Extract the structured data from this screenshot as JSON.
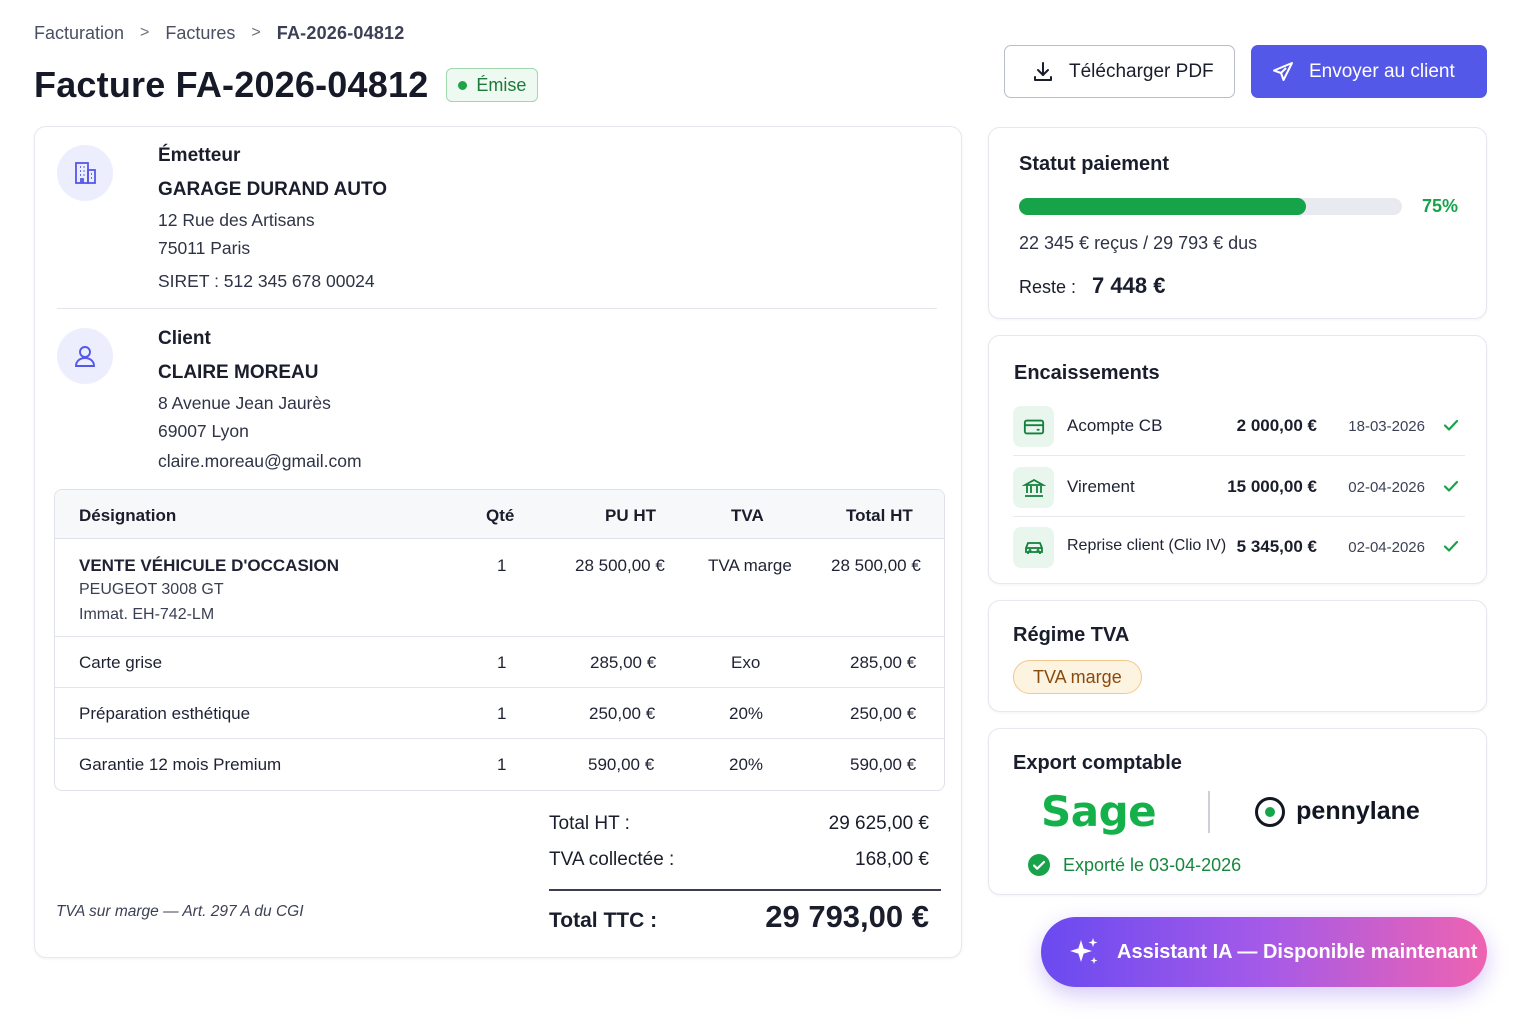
{
  "breadcrumb": {
    "items": [
      "Facturation",
      "Factures"
    ],
    "current": "FA-2026-04812",
    "separator": ">"
  },
  "header": {
    "title": "Facture FA-2026-04812",
    "status": "Émise",
    "download_label": "Télécharger PDF",
    "send_label": "Envoyer au client"
  },
  "issuer": {
    "role": "Émetteur",
    "name": "GARAGE DURAND AUTO",
    "address1": "12 Rue des Artisans",
    "address2": "75011 Paris",
    "siret": "SIRET : 512 345 678 00024"
  },
  "client": {
    "role": "Client",
    "name": "CLAIRE MOREAU",
    "address1": "8 Avenue Jean Jaurès",
    "address2": "69007 Lyon",
    "email": "claire.moreau@gmail.com"
  },
  "table": {
    "headers": {
      "designation": "Désignation",
      "qty": "Qté",
      "unit": "PU HT",
      "tva": "TVA",
      "total": "Total HT"
    },
    "rows": [
      {
        "designation": "VENTE VÉHICULE D'OCCASION",
        "sub1": "PEUGEOT 3008 GT",
        "sub2": "Immat. EH-742-LM",
        "qty": "1",
        "unit": "28 500,00 €",
        "tva": "TVA marge",
        "total": "28 500,00 €"
      },
      {
        "designation": "Carte grise",
        "qty": "1",
        "unit": "285,00 €",
        "tva": "Exo",
        "total": "285,00 €"
      },
      {
        "designation": "Préparation esthétique",
        "qty": "1",
        "unit": "250,00 €",
        "tva": "20%",
        "total": "250,00 €"
      },
      {
        "designation": "Garantie 12 mois Premium",
        "qty": "1",
        "unit": "590,00 €",
        "tva": "20%",
        "total": "590,00 €"
      }
    ]
  },
  "totals": {
    "ht_label": "Total HT :",
    "ht_value": "29 625,00 €",
    "tva_label": "TVA collectée :",
    "tva_value": "168,00 €",
    "ttc_label": "Total TTC :",
    "ttc_value": "29 793,00 €"
  },
  "legal_note": "TVA sur marge — Art. 297 A du CGI",
  "payment_status": {
    "title": "Statut paiement",
    "percent": 75,
    "percent_label": "75%",
    "received_text": "22 345 € reçus / 29 793 € dus",
    "remaining_label": "Reste :",
    "remaining_value": "7 448 €",
    "color": "#17a34a"
  },
  "payments": {
    "title": "Encaissements",
    "items": [
      {
        "icon": "card-icon",
        "label": "Acompte CB",
        "amount": "2 000,00 €",
        "date": "18-03-2026"
      },
      {
        "icon": "bank-icon",
        "label": "Virement",
        "amount": "15 000,00 €",
        "date": "02-04-2026"
      },
      {
        "icon": "car-icon",
        "label": "Reprise client (Clio IV)",
        "amount": "5 345,00 €",
        "date": "02-04-2026"
      }
    ]
  },
  "vat_regime": {
    "title": "Régime TVA",
    "value": "TVA marge"
  },
  "export": {
    "title": "Export comptable",
    "sage_label": "Sage",
    "pennylane_label": "pennylane",
    "status": "Exporté le 03-04-2026"
  },
  "assistant": {
    "label": "Assistant IA — Disponible maintenant"
  },
  "colors": {
    "primary": "#5458e8",
    "success": "#17a34a",
    "warning_bg": "#fdf3e1"
  }
}
